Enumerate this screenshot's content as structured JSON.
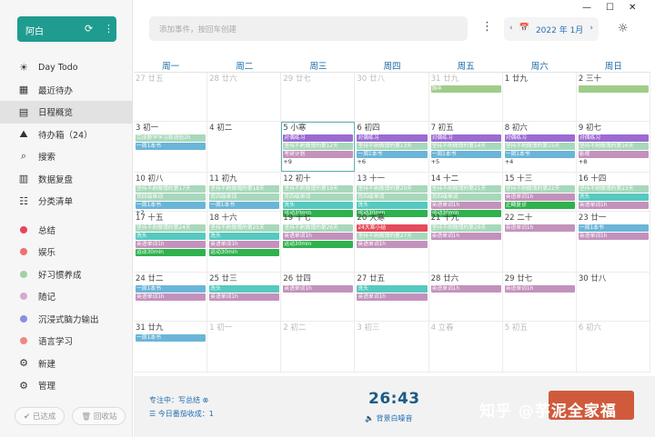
{
  "app": {
    "user": "阿白"
  },
  "sidebar": {
    "items": [
      {
        "label": "Day Todo",
        "icon": "☀"
      },
      {
        "label": "最近待办",
        "icon": "▦"
      },
      {
        "label": "日程概览",
        "icon": "▤"
      },
      {
        "label": "待办箱（24）",
        "icon": "⛰"
      },
      {
        "label": "搜索",
        "icon": "⌕"
      },
      {
        "label": "数据复盘",
        "icon": "▥"
      },
      {
        "label": "分类清单",
        "icon": "☷"
      }
    ],
    "categories": [
      {
        "label": "总结",
        "color": "#e8455a"
      },
      {
        "label": "娱乐",
        "color": "#ef6f73"
      },
      {
        "label": "好习惯养成",
        "color": "#9ed3a4"
      },
      {
        "label": "随记",
        "color": "#d6a9d1"
      },
      {
        "label": "沉浸式脑力输出",
        "color": "#8a8fe6"
      },
      {
        "label": "语言学习",
        "color": "#ec8a82"
      }
    ],
    "tools": [
      {
        "label": "新建",
        "icon": "⚙"
      },
      {
        "label": "管理",
        "icon": "⚙"
      }
    ],
    "done_btn": "已达成",
    "trash_btn": "回收站"
  },
  "topbar": {
    "search_placeholder": "添加事件，按回车创建",
    "month": "2022 年 1月"
  },
  "colors": {
    "hi": "#a0cc8a",
    "gr": "#b7b7b7",
    "pu": "#9b6bd2",
    "bl": "#6bb5d8",
    "pk": "#c392bc",
    "tl": "#56c9c0",
    "gn": "#2fb14d",
    "rd": "#e54b5c",
    "gy": "#a8d8bb"
  },
  "calendar": {
    "weekdays": [
      "周一",
      "周二",
      "周三",
      "周四",
      "周五",
      "周六",
      "周日"
    ],
    "weeks": [
      [
        {
          "d": "27 廿五",
          "dim": true
        },
        {
          "d": "28 廿六",
          "dim": true
        },
        {
          "d": "29 廿七",
          "dim": true
        },
        {
          "d": "30 廿八",
          "dim": true
        },
        {
          "d": "31 廿九",
          "dim": true,
          "ev": [
            [
              "跨年",
              "hi"
            ]
          ]
        },
        {
          "d": "1 廿九"
        },
        {
          "d": "2 三十",
          "ev": [
            [
              "",
              "hi"
            ]
          ]
        }
      ],
      [
        {
          "d": "3 初一",
          "ev": [
            [
              "完成数学学习和测验2h",
              "gy"
            ],
            [
              "一周1本书",
              "bl"
            ]
          ]
        },
        {
          "d": "4 初二"
        },
        {
          "d": "5 小寒",
          "today": true,
          "ev": [
            [
              "对偶练习",
              "pu"
            ],
            [
              "坚持不刷微博的第12天",
              "gy"
            ],
            [
              "考研计划",
              "pk"
            ]
          ],
          "more": "+9"
        },
        {
          "d": "6 初四",
          "ev": [
            [
              "对偶练习",
              "pu"
            ],
            [
              "坚持不刷微博的第13天",
              "gy"
            ],
            [
              "一周1本书",
              "bl"
            ]
          ],
          "more": "+6"
        },
        {
          "d": "7 初五",
          "ev": [
            [
              "对偶练习",
              "pu"
            ],
            [
              "坚持不刷微博的第14天",
              "gy"
            ],
            [
              "一周1本书",
              "bl"
            ]
          ],
          "more": "+5"
        },
        {
          "d": "8 初六",
          "ev": [
            [
              "对偶练习",
              "pu"
            ],
            [
              "坚持不刷微博的第15天",
              "gy"
            ],
            [
              "一周1本书",
              "bl"
            ]
          ],
          "more": "+4"
        },
        {
          "d": "9 初七",
          "ev": [
            [
              "对偶练习",
              "pu"
            ],
            [
              "坚持不刷微博的第16天",
              "gy"
            ],
            [
              "影视",
              "pk"
            ]
          ],
          "more": "+8"
        }
      ],
      [
        {
          "d": "10 初八",
          "ev": [
            [
              "坚持不刷微博的第17天",
              "gy"
            ],
            [
              "背四级单词",
              "gy"
            ],
            [
              "一周1本书",
              "bl"
            ]
          ],
          "more": "+2"
        },
        {
          "d": "11 初九",
          "ev": [
            [
              "坚持不刷微博的第18天",
              "gy"
            ],
            [
              "背四级单词",
              "gy"
            ],
            [
              "一周1本书",
              "bl"
            ]
          ]
        },
        {
          "d": "12 初十",
          "ev": [
            [
              "坚持不刷微博的第19天",
              "gy"
            ],
            [
              "背四级单词",
              "gy"
            ],
            [
              "洗头",
              "tl"
            ],
            [
              "运动30min",
              "gn"
            ]
          ]
        },
        {
          "d": "13 十一",
          "ev": [
            [
              "坚持不刷微博的第20天",
              "gy"
            ],
            [
              "背四级单词",
              "gy"
            ],
            [
              "洗头",
              "tl"
            ],
            [
              "运动30min",
              "gn"
            ]
          ]
        },
        {
          "d": "14 十二",
          "ev": [
            [
              "坚持不刷微博的第21天",
              "gy"
            ],
            [
              "背四级单词",
              "gy"
            ],
            [
              "英语单词1h",
              "pk"
            ],
            [
              "运动30min",
              "gn"
            ]
          ]
        },
        {
          "d": "15 十三",
          "ev": [
            [
              "坚持不刷微博的第22天",
              "gy"
            ],
            [
              "英语单词1h",
              "pk"
            ],
            [
              "正畸复诊",
              "gn"
            ]
          ]
        },
        {
          "d": "16 十四",
          "ev": [
            [
              "坚持不刷微博的第23天",
              "gy"
            ],
            [
              "洗头",
              "tl"
            ],
            [
              "英语单词1h",
              "pk"
            ]
          ]
        }
      ],
      [
        {
          "d": "17 十五",
          "ev": [
            [
              "坚持不刷微博的第24天",
              "gy"
            ],
            [
              "洗头",
              "tl"
            ],
            [
              "英语单词1h",
              "pk"
            ],
            [
              "运动30min",
              "gn"
            ]
          ]
        },
        {
          "d": "18 十六",
          "ev": [
            [
              "坚持不刷微博的第25天",
              "gy"
            ],
            [
              "洗头",
              "tl"
            ],
            [
              "英语单词1h",
              "pk"
            ],
            [
              "运动30min",
              "gn"
            ]
          ]
        },
        {
          "d": "19 十七",
          "ev": [
            [
              "坚持不刷微博的第26天",
              "gy"
            ],
            [
              "英语单词1h",
              "pk"
            ],
            [
              "运动30min",
              "gn"
            ]
          ]
        },
        {
          "d": "20 大寒",
          "ev": [
            [
              "24大寒小结",
              "rd"
            ],
            [
              "坚持不刷微博的第27天",
              "gy"
            ],
            [
              "英语单词1h",
              "pk"
            ]
          ]
        },
        {
          "d": "21 十九",
          "ev": [
            [
              "坚持不刷微博的第28天",
              "gy"
            ],
            [
              "英语单词1h",
              "pk"
            ]
          ]
        },
        {
          "d": "22 二十",
          "ev": [
            [
              "英语单词1h",
              "pk"
            ]
          ]
        },
        {
          "d": "23 廿一",
          "ev": [
            [
              "一周1本书",
              "bl"
            ],
            [
              "英语单词1h",
              "pk"
            ]
          ]
        }
      ],
      [
        {
          "d": "24 廿二",
          "ev": [
            [
              "一周1本书",
              "bl"
            ],
            [
              "英语单词1h",
              "pk"
            ]
          ]
        },
        {
          "d": "25 廿三",
          "ev": [
            [
              "洗头",
              "tl"
            ],
            [
              "英语单词1h",
              "pk"
            ]
          ]
        },
        {
          "d": "26 廿四",
          "ev": [
            [
              "英语单词1h",
              "pk"
            ]
          ]
        },
        {
          "d": "27 廿五",
          "ev": [
            [
              "洗头",
              "tl"
            ],
            [
              "英语单词1h",
              "pk"
            ]
          ]
        },
        {
          "d": "28 廿六",
          "ev": [
            [
              "英语单词1h",
              "pk"
            ]
          ]
        },
        {
          "d": "29 廿七",
          "ev": [
            [
              "英语单词1h",
              "pk"
            ]
          ]
        },
        {
          "d": "30 廿八"
        }
      ],
      [
        {
          "d": "31 廿九",
          "ev": [
            [
              "一周1本书",
              "bl"
            ]
          ]
        },
        {
          "d": "1 初一",
          "dim": true
        },
        {
          "d": "2 初二",
          "dim": true
        },
        {
          "d": "3 初三",
          "dim": true
        },
        {
          "d": "4 立春",
          "dim": true
        },
        {
          "d": "5 初五",
          "dim": true
        },
        {
          "d": "6 初六",
          "dim": true
        }
      ]
    ]
  },
  "footer": {
    "focus": "专注中：写总结",
    "today_added": "今日番茄收成：1",
    "timer": "26:43",
    "noise": "背景白噪音",
    "watermark": "知乎 @芋泥全家福"
  }
}
